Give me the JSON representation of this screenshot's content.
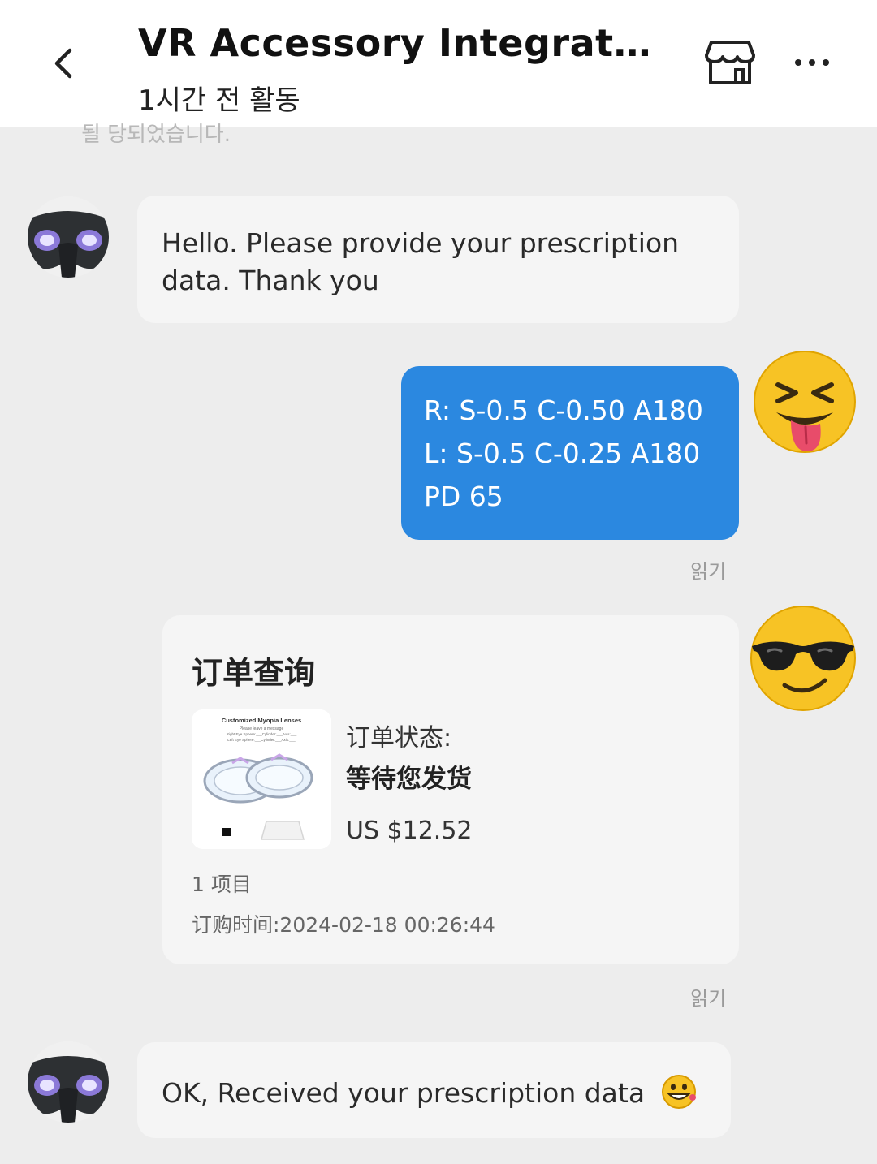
{
  "header": {
    "title": "VR Accessory Integrati...",
    "subtitle": "1시간 전 활동",
    "back_icon": "chevron-left-icon",
    "store_icon": "store-icon",
    "more_icon": "more-horizontal-icon"
  },
  "system_notice_fragment": "될 당되었습니다.",
  "messages": [
    {
      "from": "seller",
      "text": "Hello. Please provide your prescription data. Thank you"
    },
    {
      "from": "me",
      "lines": [
        "R: S-0.5 C-0.50 A180",
        "L: S-0.5 C-0.25 A180",
        "PD 65"
      ],
      "read_label": "읽기"
    },
    {
      "from": "me",
      "type": "order_card",
      "card": {
        "title": "订单查询",
        "status_label": "订单状态:",
        "status_value": "等待您发货",
        "price": "US $12.52",
        "items": "1 项目",
        "order_time": "订购时间:2024-02-18 00:26:44",
        "thumb_title": "Customized Myopia Lenses",
        "thumb_line1": "Please leave a message",
        "thumb_line2": "Right Eye Sphere:___Cylinder:___Axis:___",
        "thumb_line3": "Left Eye Sphere:___Cylinder:___Axis:___"
      },
      "read_label": "읽기"
    },
    {
      "from": "seller",
      "text": "OK, Received your prescription data",
      "emoji": "grinning-face-emoji"
    }
  ],
  "colors": {
    "background": "#ededed",
    "bubble_in": "#f5f5f5",
    "bubble_out": "#2b88e0",
    "emoji_yellow": "#f7c325"
  }
}
